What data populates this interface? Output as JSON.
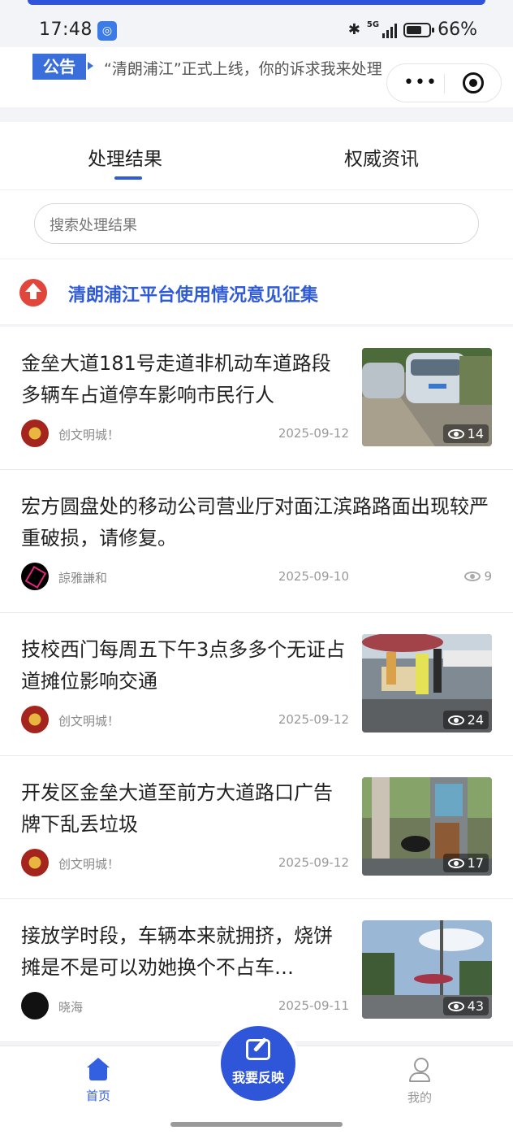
{
  "status_bar": {
    "time": "17:48",
    "network": "5G",
    "battery": "66%"
  },
  "notice": {
    "tag": "公告",
    "text": "“清朗浦江”正式上线，你的诉求我来处理"
  },
  "capsule": {
    "more_icon": "more-dots-icon",
    "close_icon": "close-target-icon"
  },
  "tabs": [
    {
      "label": "处理结果",
      "active": true
    },
    {
      "label": "权威资讯",
      "active": false
    }
  ],
  "search": {
    "placeholder": "搜索处理结果"
  },
  "promo": {
    "text": "清朗浦江平台使用情况意见征集"
  },
  "feed": [
    {
      "title": "金垒大道181号走道非机动车道路段多辆车占道停车影响市民行人",
      "author": "创文明城！",
      "date": "2025-09-12",
      "views": "14"
    },
    {
      "title": "宏方圆盘处的移动公司营业厅对面江滨路路面出现较严重破损，请修复。",
      "author": "諒雅謙和",
      "date": "2025-09-10",
      "views": "9"
    },
    {
      "title": "技校西门每周五下午3点多多个无证占道摊位影响交通",
      "author": "创文明城！",
      "date": "2025-09-12",
      "views": "24"
    },
    {
      "title": "开发区金垒大道至前方大道路口广告牌下乱丢垃圾",
      "author": "创文明城！",
      "date": "2025-09-12",
      "views": "17"
    },
    {
      "title": "接放学时段，车辆本来就拥挤，烧饼摊是不是可以劝她换个不占车…",
      "author": "晓海",
      "date": "2025-09-11",
      "views": "43"
    }
  ],
  "tabbar": {
    "home": "首页",
    "report": "我要反映",
    "me": "我的"
  },
  "colors": {
    "primary": "#2f55d8",
    "promo_red": "#e0463c",
    "notice_blue": "#3a6fdb"
  }
}
